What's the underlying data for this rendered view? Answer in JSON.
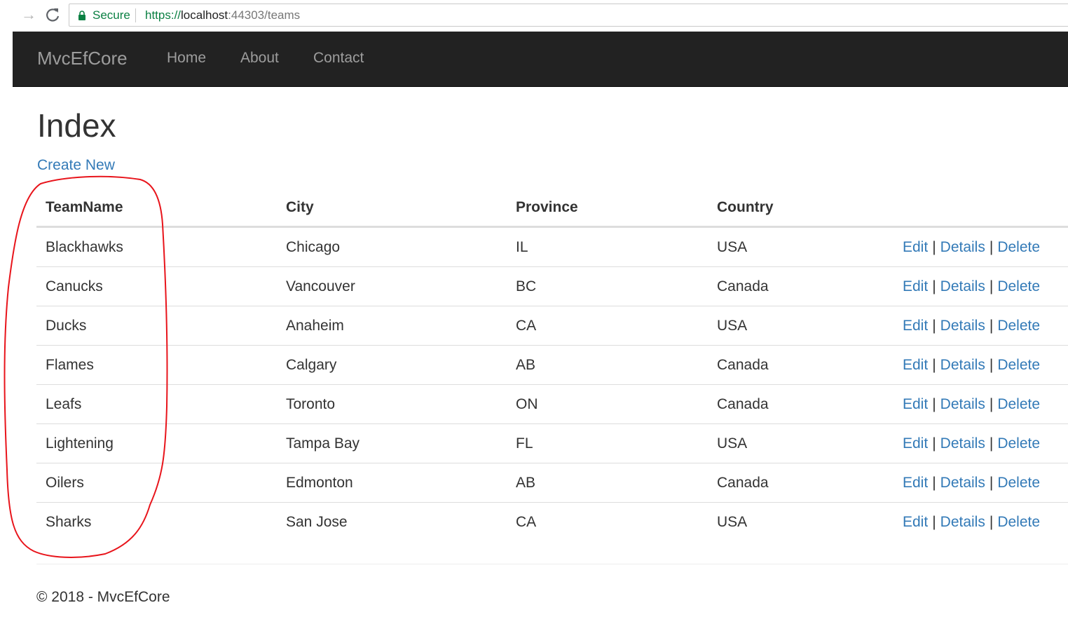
{
  "browser": {
    "secure_label": "Secure",
    "url_scheme": "https://",
    "url_host": "localhost",
    "url_rest": ":44303/teams"
  },
  "navbar": {
    "brand": "MvcEfCore",
    "links": [
      "Home",
      "About",
      "Contact"
    ]
  },
  "page": {
    "title": "Index",
    "create_link": "Create New"
  },
  "table": {
    "headers": [
      "TeamName",
      "City",
      "Province",
      "Country"
    ],
    "rows": [
      [
        "Blackhawks",
        "Chicago",
        "IL",
        "USA"
      ],
      [
        "Canucks",
        "Vancouver",
        "BC",
        "Canada"
      ],
      [
        "Ducks",
        "Anaheim",
        "CA",
        "USA"
      ],
      [
        "Flames",
        "Calgary",
        "AB",
        "Canada"
      ],
      [
        "Leafs",
        "Toronto",
        "ON",
        "Canada"
      ],
      [
        "Lightening",
        "Tampa Bay",
        "FL",
        "USA"
      ],
      [
        "Oilers",
        "Edmonton",
        "AB",
        "Canada"
      ],
      [
        "Sharks",
        "San Jose",
        "CA",
        "USA"
      ]
    ],
    "actions": [
      "Edit",
      "Details",
      "Delete"
    ],
    "separator": "|"
  },
  "footer": {
    "text": "© 2018 - MvcEfCore"
  },
  "colors": {
    "navbar_bg": "#222222",
    "link": "#337ab7",
    "secure": "#0b8043",
    "annotation": "#e8141b"
  }
}
